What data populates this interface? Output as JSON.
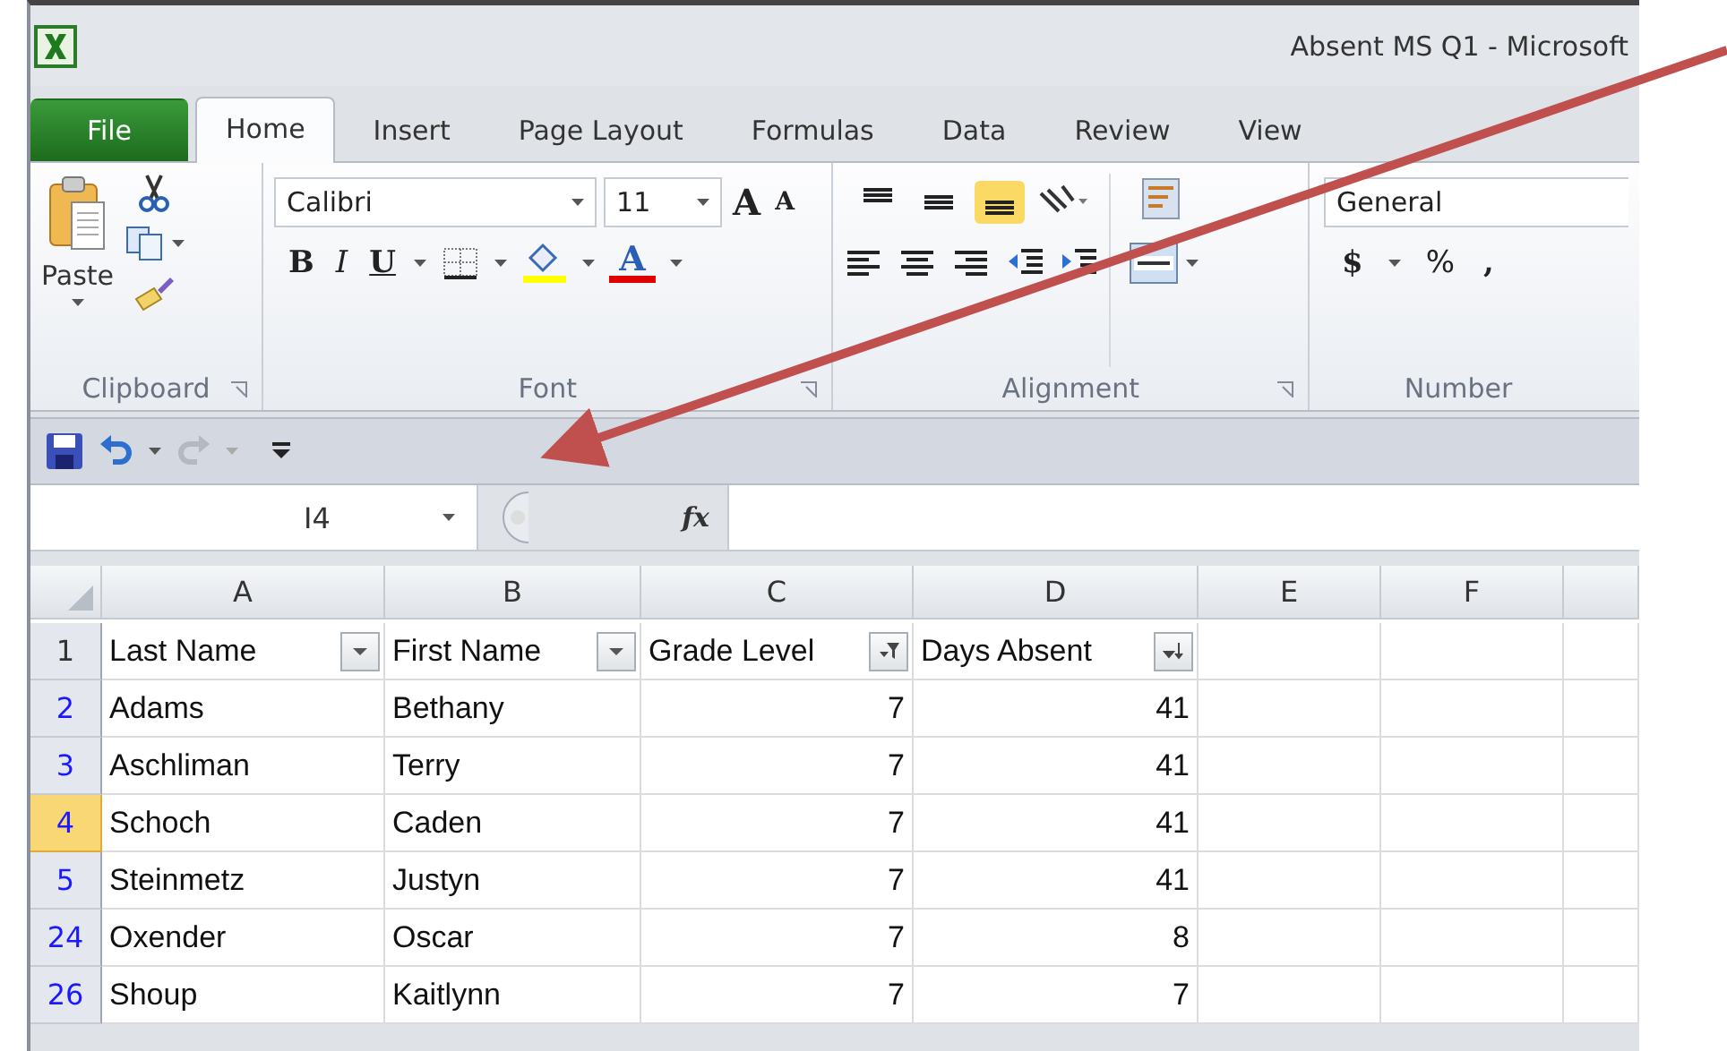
{
  "window": {
    "title": "Absent MS Q1  - Microsoft"
  },
  "tabs": [
    {
      "label": "File",
      "kind": "file",
      "selected": false
    },
    {
      "label": "Home",
      "kind": "tab",
      "selected": true
    },
    {
      "label": "Insert",
      "kind": "tab",
      "selected": false
    },
    {
      "label": "Page Layout",
      "kind": "tab",
      "selected": false
    },
    {
      "label": "Formulas",
      "kind": "tab",
      "selected": false
    },
    {
      "label": "Data",
      "kind": "tab",
      "selected": false
    },
    {
      "label": "Review",
      "kind": "tab",
      "selected": false
    },
    {
      "label": "View",
      "kind": "tab",
      "selected": false
    }
  ],
  "ribbon": {
    "clipboard": {
      "label": "Clipboard",
      "paste": "Paste"
    },
    "font": {
      "label": "Font",
      "family": "Calibri",
      "size": "11",
      "grow": "A",
      "shrink": "A",
      "bold": "B",
      "italic": "I",
      "underline": "U",
      "font_color": "A"
    },
    "alignment": {
      "label": "Alignment",
      "vertical": [
        {
          "selected": false
        },
        {
          "selected": false
        },
        {
          "selected": true
        }
      ]
    },
    "number": {
      "label": "Number",
      "format": "General",
      "currency": "$",
      "percent": "%",
      "comma": ","
    }
  },
  "formula_bar": {
    "name_box": "I4",
    "function_label": "fx"
  },
  "columns": [
    "A",
    "B",
    "C",
    "D",
    "E",
    "F"
  ],
  "header": {
    "number": "1",
    "cells": [
      {
        "text": "Last Name",
        "kind": "dropdown"
      },
      {
        "text": "First Name",
        "kind": "dropdown"
      },
      {
        "text": "Grade Level",
        "kind": "filtered"
      },
      {
        "text": "Days Absent",
        "kind": "sorted"
      }
    ]
  },
  "rows": [
    {
      "number": "2",
      "selected": false,
      "cells": [
        "Adams",
        "Bethany",
        "7",
        "41"
      ]
    },
    {
      "number": "3",
      "selected": false,
      "cells": [
        "Aschliman",
        "Terry",
        "7",
        "41"
      ]
    },
    {
      "number": "4",
      "selected": true,
      "cells": [
        "Schoch",
        "Caden",
        "7",
        "41"
      ]
    },
    {
      "number": "5",
      "selected": false,
      "cells": [
        "Steinmetz",
        "Justyn",
        "7",
        "41"
      ]
    },
    {
      "number": "24",
      "selected": false,
      "cells": [
        "Oxender",
        "Oscar",
        "7",
        "8"
      ]
    },
    {
      "number": "26",
      "selected": false,
      "cells": [
        "Shoup",
        "Kaitlynn",
        "7",
        "7"
      ]
    }
  ]
}
